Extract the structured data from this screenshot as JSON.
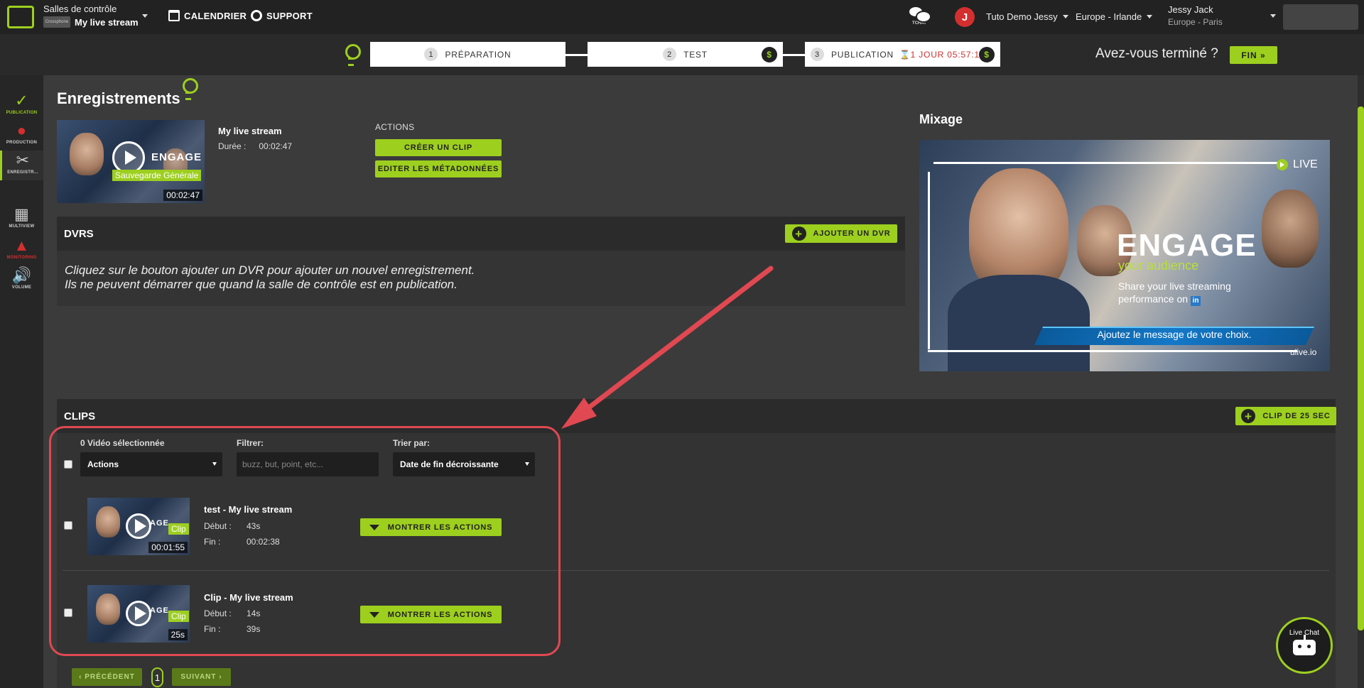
{
  "topbar": {
    "room_label": "Salles de contrôle",
    "room_chip": "Crossphone",
    "room_name": "My live stream",
    "calendar": "CALENDRIER",
    "support": "SUPPORT",
    "tchat": "TCHAT",
    "avatar_letter": "J",
    "account": "Tuto Demo Jessy",
    "region": "Europe - Irlande",
    "user_name": "Jessy Jack",
    "user_tz": "Europe - Paris"
  },
  "steps": [
    {
      "num": "1",
      "label": "PRÉPARATION"
    },
    {
      "num": "2",
      "label": "TEST",
      "badge": "$"
    },
    {
      "num": "3",
      "label": "PUBLICATION",
      "timer": "⌛1 JOUR 05:57:10",
      "badge": "$"
    }
  ],
  "finish": {
    "question": "Avez-vous terminé ?",
    "button": "FIN »"
  },
  "sidebar": [
    {
      "label": "PUBLICATION",
      "glyph": "✓"
    },
    {
      "label": "PRODUCTION",
      "glyph": "●"
    },
    {
      "label": "ENREGISTR...",
      "glyph": "✂"
    },
    {
      "label": "MULTIVIEW",
      "glyph": "▦"
    },
    {
      "label": "MONITORING",
      "glyph": "▲"
    },
    {
      "label": "VOLUME",
      "glyph": "🔊"
    }
  ],
  "recordings": {
    "title": "Enregistrements",
    "item": {
      "name": "My live stream",
      "duration_label": "Durée :",
      "duration": "00:02:47",
      "badge": "Sauvegarde Générale",
      "thumb_text": "ENGAGE"
    },
    "actions_label": "ACTIONS",
    "create_clip": "CRÉER UN CLIP",
    "edit_meta": "EDITER LES MÉTADONNÉES"
  },
  "dvrs": {
    "title": "DVRS",
    "add_button": "AJOUTER UN DVR",
    "plus": "+",
    "message_line1": "Cliquez sur le bouton ajouter un DVR pour ajouter un nouvel enregistrement.",
    "message_line2": "Ils ne peuvent démarrer que quand la salle de contrôle est en publication."
  },
  "mixage": {
    "title": "Mixage",
    "live": "LIVE",
    "engage": "ENGAGE",
    "audience": "your audience",
    "share": "Share your live streaming performance on",
    "linkedin": "in",
    "banner": "Ajoutez le message de votre choix.",
    "brand": "ulive.io"
  },
  "clips": {
    "title": "CLIPS",
    "add_button": "CLIP DE 25 SEC",
    "plus": "+",
    "selected_label": "0 Vidéo sélectionnée",
    "actions_select": "Actions",
    "filter_label": "Filtrer:",
    "filter_placeholder": "buzz, but, point, etc...",
    "sort_label": "Trier par:",
    "sort_value": "Date de fin décroissante",
    "items": [
      {
        "title": "test - My live stream",
        "start_label": "Début :",
        "start": "43s",
        "end_label": "Fin :",
        "end": "00:02:38",
        "badge": "Clip",
        "duration": "00:01:55",
        "thumb_text": "AGE",
        "show_actions": "MONTRER LES ACTIONS"
      },
      {
        "title": "Clip - My live stream",
        "start_label": "Début :",
        "start": "14s",
        "end_label": "Fin :",
        "end": "39s",
        "badge": "Clip",
        "duration": "25s",
        "thumb_text": "AGE",
        "show_actions": "MONTRER LES ACTIONS"
      }
    ],
    "prev": "‹ PRÉCÉDENT",
    "page": "1",
    "next": "SUIVANT ›"
  },
  "livechat": {
    "label": "Live Chat"
  },
  "colors": {
    "accent": "#9dcf1f",
    "annotation": "#e04852",
    "danger": "#d32f2f"
  }
}
